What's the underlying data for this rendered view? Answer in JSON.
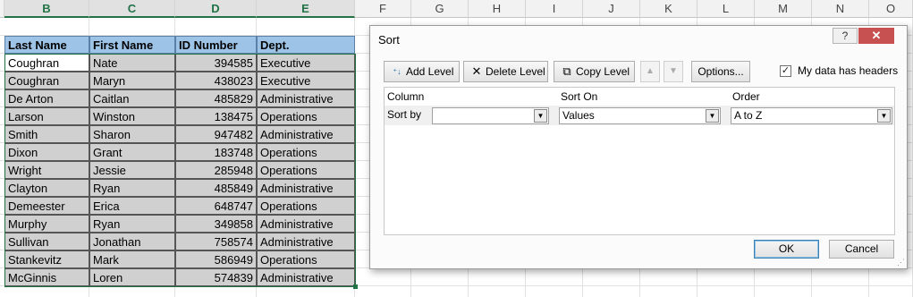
{
  "sheet": {
    "columns": [
      "B",
      "C",
      "D",
      "E",
      "F",
      "G",
      "H",
      "I",
      "J",
      "K",
      "L",
      "M",
      "N",
      "O"
    ],
    "headers": [
      "Last Name",
      "First Name",
      "ID Number",
      "Dept."
    ],
    "rows": [
      [
        "Coughran",
        "Nate",
        "394585",
        "Executive"
      ],
      [
        "Coughran",
        "Maryn",
        "438023",
        "Executive"
      ],
      [
        "De Arton",
        "Caitlan",
        "485829",
        "Administrative"
      ],
      [
        "Larson",
        "Winston",
        "138475",
        "Operations"
      ],
      [
        "Smith",
        "Sharon",
        "947482",
        "Administrative"
      ],
      [
        "Dixon",
        "Grant",
        "183748",
        "Operations"
      ],
      [
        "Wright",
        "Jessie",
        "285948",
        "Operations"
      ],
      [
        "Clayton",
        "Ryan",
        "485849",
        "Administrative"
      ],
      [
        "Demeester",
        "Erica",
        "648747",
        "Operations"
      ],
      [
        "Murphy",
        "Ryan",
        "349858",
        "Administrative"
      ],
      [
        "Sullivan",
        "Jonathan",
        "758574",
        "Administrative"
      ],
      [
        "Stankevitz",
        "Mark",
        "586949",
        "Operations"
      ],
      [
        "McGinnis",
        "Loren",
        "574839",
        "Administrative"
      ]
    ]
  },
  "dialog": {
    "title": "Sort",
    "help_label": "?",
    "close_label": "✕",
    "toolbar": {
      "add_level": "Add Level",
      "delete_level": "Delete Level",
      "copy_level": "Copy Level",
      "options": "Options...",
      "move_up": "▲",
      "move_down": "▼"
    },
    "my_data_has_headers": "My data has headers",
    "my_data_has_headers_checked": true,
    "check_mark": "✓",
    "columns": {
      "column": "Column",
      "sort_on": "Sort On",
      "order": "Order"
    },
    "level": {
      "label": "Sort by",
      "column_value": "",
      "sort_on_value": "Values",
      "order_value": "A to Z"
    },
    "dropdown_arrow": "▼",
    "ok": "OK",
    "cancel": "Cancel"
  },
  "colors": {
    "header_fill": "#9dc3e6",
    "data_fill": "#d0d0d0",
    "selection": "#217346",
    "close_button": "#c75050"
  },
  "icons": {
    "add_level": "add-level-icon",
    "delete_level": "delete-x-icon",
    "copy_level": "copy-icon"
  }
}
